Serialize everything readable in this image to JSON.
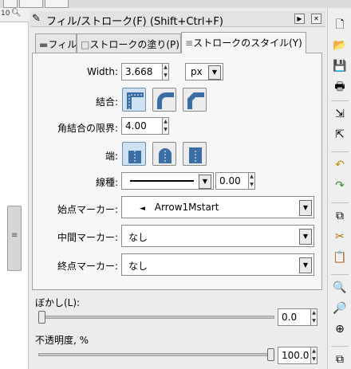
{
  "ruler": {
    "number": "10",
    "zoom_icon": "magnifier"
  },
  "dialog": {
    "title": "フィル/ストローク(F) (Shift+Ctrl+F)",
    "title_icon": "pencil-icon"
  },
  "tabs": [
    {
      "label": "フィル",
      "prefix": "▬",
      "active": false
    },
    {
      "label": "ストロークの塗り(P)",
      "prefix": "□",
      "active": false
    },
    {
      "label": "ストロークのスタイル(Y)",
      "prefix": "≡",
      "active": true
    }
  ],
  "stroke_style": {
    "width_label": "Width:",
    "width_value": "3.668",
    "unit_value": "px",
    "join_label": "結合:",
    "join_options": [
      "miter-join",
      "round-join",
      "bevel-join"
    ],
    "join_selected": "miter-join",
    "miter_label": "角結合の限界:",
    "miter_value": "4.00",
    "cap_label": "端:",
    "cap_options": [
      "butt-cap",
      "round-cap",
      "square-cap"
    ],
    "cap_selected": "butt-cap",
    "dash_label": "線種:",
    "dash_offset": "0.00",
    "start_marker_label": "始点マーカー:",
    "start_marker_value": "Arrow1Mstart",
    "start_marker_glyph": "◄",
    "mid_marker_label": "中間マーカー:",
    "mid_marker_value": "なし",
    "end_marker_label": "終点マーカー:",
    "end_marker_value": "なし"
  },
  "blur": {
    "label": "ぼかし(L):",
    "value": "0.0",
    "level_percent": 0
  },
  "opacity": {
    "label": "不透明度, %",
    "value": "100.0",
    "level_percent": 100
  },
  "right_toolbar": [
    "new-document-icon",
    "open-icon",
    "save-icon",
    "print-icon",
    "import-icon",
    "export-icon",
    "undo-icon",
    "redo-icon",
    "copy-icon",
    "cut-icon",
    "paste-icon",
    "zoom-selection-icon",
    "zoom-drawing-icon",
    "zoom-page-icon",
    "duplicate-icon"
  ]
}
